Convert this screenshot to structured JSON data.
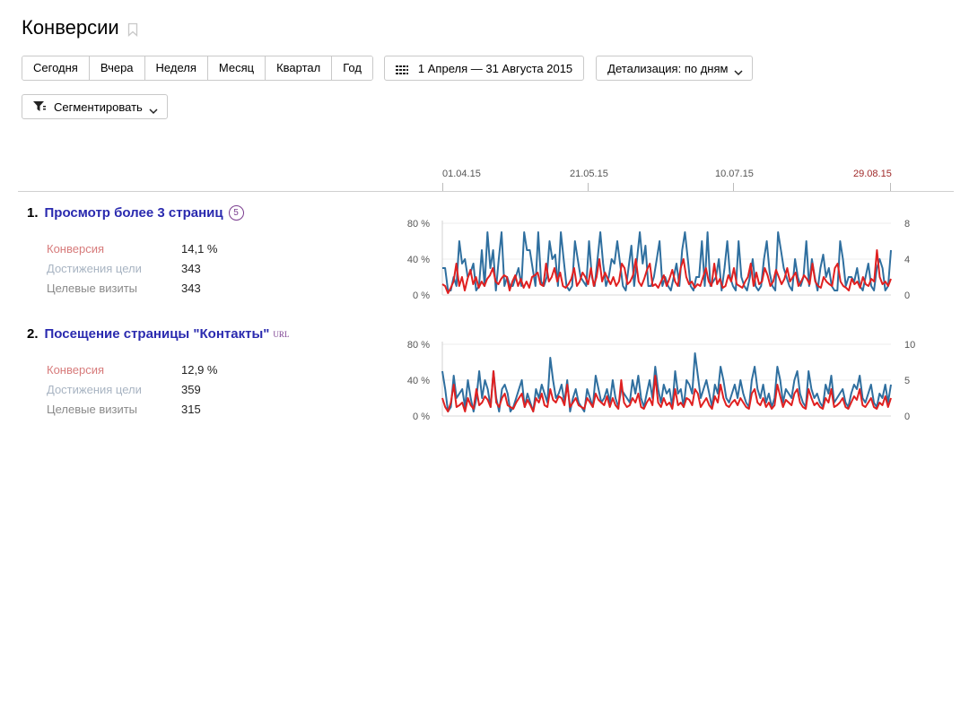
{
  "header": {
    "title": "Конверсии",
    "bookmark_icon": "bookmark-icon"
  },
  "toolbar": {
    "periods": [
      "Сегодня",
      "Вчера",
      "Неделя",
      "Месяц",
      "Квартал",
      "Год"
    ],
    "date_range": "1 Апреля — 31 Августа 2015",
    "detail_label": "Детализация: по дням",
    "segment_label": "Сегментировать"
  },
  "timeline": {
    "ticks": [
      {
        "label": "01.04.15",
        "highlight": false
      },
      {
        "label": "21.05.15",
        "highlight": false
      },
      {
        "label": "10.07.15",
        "highlight": false
      },
      {
        "label": "29.08.15",
        "highlight": true
      }
    ]
  },
  "colors": {
    "conversion": "#e02020",
    "visits": "#2f6f9f",
    "link": "#2a2aaf",
    "accent": "#7a3c8f"
  },
  "goals": [
    {
      "num": "1.",
      "name": "Просмотр более 3 страниц",
      "badge": "5",
      "url_tag": "",
      "conversion_label": "Конверсия",
      "conversion_value": "14,1 %",
      "achievements_label": "Достижения цели",
      "achievements_value": "343",
      "visits_label": "Целевые визиты",
      "visits_value": "343"
    },
    {
      "num": "2.",
      "name": "Посещение страницы \"Контакты\"",
      "badge": "",
      "url_tag": "URL",
      "conversion_label": "Конверсия",
      "conversion_value": "12,9 %",
      "achievements_label": "Достижения цели",
      "achievements_value": "359",
      "visits_label": "Целевые визиты",
      "visits_value": "315"
    }
  ],
  "chart_data": [
    {
      "type": "line",
      "left_axis": {
        "ticks": [
          "80 %",
          "40 %",
          "0 %"
        ],
        "ylim": [
          0,
          80
        ]
      },
      "right_axis": {
        "ticks": [
          "8",
          "4",
          "0"
        ],
        "ylim": [
          0,
          8
        ]
      },
      "series": [
        {
          "values": [
            12,
            10,
            2,
            8,
            15,
            35,
            10,
            20,
            5,
            18,
            28,
            12,
            20,
            8,
            15,
            10,
            18,
            22,
            30,
            15,
            12,
            18,
            22,
            20,
            5,
            15,
            22,
            10,
            18,
            8,
            15,
            8,
            20,
            22,
            25,
            12,
            10,
            35,
            15,
            20,
            30,
            15,
            25,
            10,
            8,
            12,
            18,
            30,
            10,
            15,
            25,
            20,
            12,
            30,
            10,
            20,
            40,
            15,
            25,
            18,
            12,
            20,
            10,
            15,
            35,
            30,
            12,
            15,
            22,
            40,
            15,
            10,
            18,
            28,
            35,
            10,
            12,
            8,
            15,
            22,
            10,
            18,
            28,
            15,
            10,
            30,
            40,
            20,
            12,
            15,
            8,
            12,
            10,
            20,
            30,
            15,
            10,
            35,
            12,
            18,
            8,
            10,
            22,
            15,
            30,
            12,
            10,
            8,
            15,
            20,
            35,
            10,
            25,
            12,
            15,
            30,
            22,
            10,
            15,
            28,
            20,
            12,
            18,
            30,
            15,
            20,
            25,
            10,
            15,
            22,
            18,
            12,
            35,
            15,
            10,
            8,
            20,
            15,
            12,
            10,
            30,
            35,
            15,
            10,
            8,
            5,
            18,
            12,
            15,
            8,
            20,
            12,
            10,
            18,
            15,
            50,
            20,
            12,
            15,
            10,
            18
          ]
        },
        {
          "values": [
            30,
            30,
            5,
            5,
            20,
            10,
            60,
            35,
            40,
            20,
            25,
            35,
            5,
            10,
            50,
            10,
            70,
            30,
            50,
            5,
            40,
            70,
            10,
            20,
            10,
            10,
            20,
            30,
            10,
            70,
            50,
            50,
            30,
            10,
            70,
            15,
            10,
            20,
            60,
            40,
            45,
            10,
            70,
            40,
            10,
            5,
            10,
            60,
            40,
            20,
            15,
            10,
            60,
            20,
            10,
            40,
            70,
            35,
            10,
            20,
            40,
            35,
            60,
            35,
            10,
            5,
            30,
            55,
            10,
            40,
            70,
            35,
            55,
            10,
            10,
            20,
            40,
            60,
            10,
            20,
            10,
            5,
            20,
            35,
            10,
            50,
            70,
            40,
            10,
            5,
            20,
            20,
            60,
            10,
            70,
            10,
            15,
            20,
            40,
            5,
            30,
            60,
            20,
            10,
            5,
            60,
            20,
            10,
            5,
            20,
            40,
            10,
            5,
            10,
            40,
            60,
            25,
            10,
            5,
            70,
            50,
            30,
            20,
            10,
            5,
            40,
            20,
            10,
            20,
            60,
            10,
            40,
            20,
            5,
            30,
            45,
            20,
            30,
            10,
            5,
            5,
            60,
            40,
            10,
            20,
            20,
            15,
            30,
            10,
            5,
            20,
            35,
            10,
            5,
            30,
            40,
            30,
            5,
            10,
            50
          ]
        }
      ]
    },
    {
      "type": "line",
      "left_axis": {
        "ticks": [
          "80 %",
          "40 %",
          "0 %"
        ],
        "ylim": [
          0,
          80
        ]
      },
      "right_axis": {
        "ticks": [
          "10",
          "5",
          "0"
        ],
        "ylim": [
          0,
          10
        ]
      },
      "series": [
        {
          "values": [
            20,
            10,
            5,
            15,
            35,
            10,
            12,
            15,
            5,
            20,
            12,
            8,
            30,
            12,
            15,
            22,
            18,
            10,
            50,
            15,
            10,
            20,
            25,
            12,
            10,
            8,
            15,
            20,
            25,
            10,
            18,
            12,
            5,
            20,
            15,
            25,
            12,
            10,
            30,
            18,
            15,
            22,
            20,
            12,
            35,
            10,
            15,
            20,
            12,
            10,
            8,
            20,
            15,
            10,
            25,
            18,
            15,
            12,
            22,
            10,
            20,
            12,
            8,
            40,
            15,
            10,
            12,
            20,
            15,
            25,
            10,
            8,
            15,
            20,
            12,
            45,
            15,
            10,
            20,
            12,
            15,
            8,
            30,
            12,
            15,
            10,
            20,
            18,
            12,
            30,
            25,
            10,
            15,
            20,
            12,
            8,
            22,
            15,
            35,
            20,
            12,
            10,
            15,
            18,
            12,
            20,
            15,
            10,
            8,
            25,
            30,
            15,
            12,
            20,
            10,
            15,
            8,
            12,
            35,
            22,
            10,
            18,
            15,
            12,
            25,
            30,
            15,
            10,
            8,
            30,
            20,
            12,
            15,
            10,
            8,
            20,
            15,
            30,
            10,
            12,
            15,
            20,
            10,
            8,
            15,
            22,
            18,
            30,
            12,
            10,
            15,
            20,
            10,
            8,
            15,
            12,
            22,
            10,
            20
          ]
        },
        {
          "values": [
            50,
            30,
            5,
            10,
            45,
            20,
            25,
            30,
            10,
            40,
            20,
            5,
            20,
            50,
            20,
            40,
            30,
            10,
            50,
            20,
            5,
            30,
            35,
            25,
            5,
            10,
            20,
            30,
            40,
            10,
            25,
            15,
            5,
            30,
            20,
            35,
            25,
            15,
            65,
            40,
            20,
            25,
            35,
            15,
            40,
            5,
            20,
            30,
            15,
            10,
            5,
            30,
            20,
            10,
            45,
            30,
            15,
            20,
            30,
            15,
            40,
            20,
            10,
            30,
            25,
            20,
            15,
            40,
            25,
            45,
            20,
            10,
            25,
            40,
            20,
            55,
            30,
            15,
            35,
            25,
            30,
            10,
            50,
            25,
            30,
            10,
            40,
            35,
            25,
            70,
            45,
            20,
            30,
            40,
            25,
            10,
            35,
            25,
            55,
            40,
            20,
            15,
            25,
            35,
            20,
            40,
            25,
            15,
            10,
            40,
            55,
            30,
            20,
            35,
            15,
            25,
            10,
            20,
            55,
            40,
            15,
            30,
            25,
            20,
            40,
            50,
            25,
            15,
            10,
            50,
            30,
            20,
            25,
            15,
            10,
            35,
            25,
            45,
            15,
            20,
            25,
            30,
            15,
            10,
            25,
            35,
            30,
            45,
            20,
            15,
            25,
            35,
            15,
            10,
            25,
            20,
            35,
            15,
            35
          ]
        }
      ]
    }
  ]
}
